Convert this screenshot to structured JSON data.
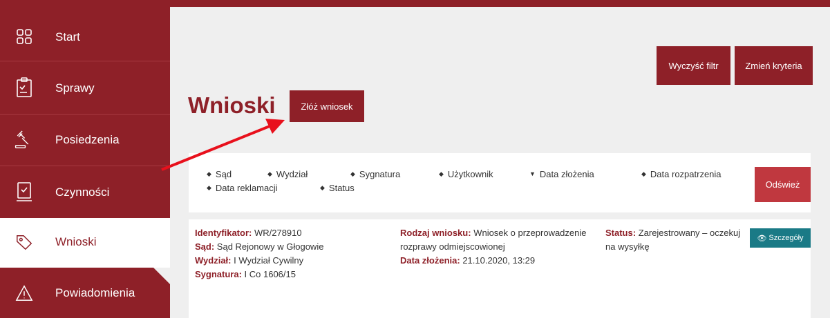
{
  "colors": {
    "brand": "#8e2028",
    "refresh": "#c0383f",
    "details": "#1a7a86",
    "background": "#efefef"
  },
  "sidebar": {
    "items": [
      {
        "label": "Start",
        "icon": "grid-icon"
      },
      {
        "label": "Sprawy",
        "icon": "clipboard-icon"
      },
      {
        "label": "Posiedzenia",
        "icon": "gavel-icon"
      },
      {
        "label": "Czynności",
        "icon": "document-check-icon"
      },
      {
        "label": "Wnioski",
        "icon": "tag-icon",
        "active": true
      },
      {
        "label": "Powiadomienia",
        "icon": "warning-icon"
      }
    ]
  },
  "toolbar": {
    "clear_filter": "Wyczyść filtr",
    "change_criteria": "Zmień kryteria"
  },
  "page": {
    "title": "Wnioski",
    "submit_button": "Złóż wniosek"
  },
  "filters": {
    "sort_fields": [
      "Sąd",
      "Wydział",
      "Sygnatura",
      "Użytkownik",
      "Data złożenia",
      "Data rozpatrzenia",
      "Data reklamacji",
      "Status"
    ],
    "refresh_button": "Odśwież"
  },
  "request": {
    "id_key": "Identyfikator:",
    "id_value": "WR/278910",
    "court_key": "Sąd:",
    "court_value": "Sąd Rejonowy w Głogowie",
    "department_key": "Wydział:",
    "department_value": "I Wydział Cywilny",
    "signature_key": "Sygnatura:",
    "signature_value": "I Co 1606/15",
    "type_key": "Rodzaj wniosku:",
    "type_value_line1": "Wniosek o przeprowadzenie",
    "type_value_line2": "rozprawy odmiejscowionej",
    "date_key": "Data złożenia:",
    "date_value": "21.10.2020, 13:29",
    "status_key": "Status:",
    "status_value_line1": "Zarejestrowany – oczekuj",
    "status_value_line2": "na wysyłkę",
    "details_button": "Szczegóły"
  }
}
